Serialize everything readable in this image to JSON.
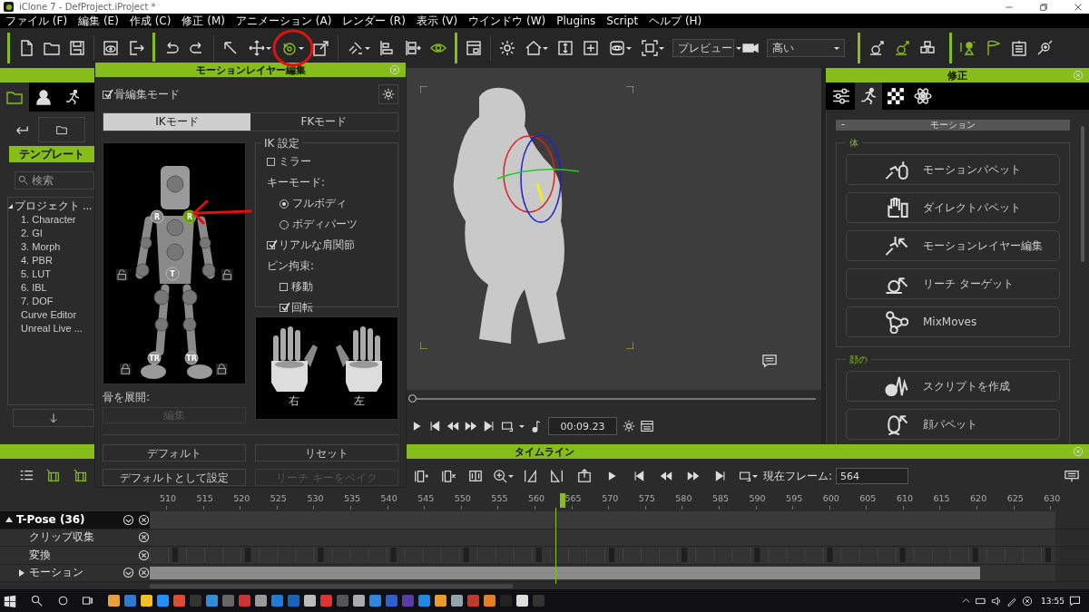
{
  "window": {
    "title": "iClone 7 - DefProject.iProject *"
  },
  "menu": [
    "ファイル (F)",
    "編集 (E)",
    "作成 (C)",
    "修正 (M)",
    "アニメーション (A)",
    "レンダー (R)",
    "表示 (V)",
    "ウインドウ (W)",
    "Plugins",
    "Script",
    "ヘルプ (H)"
  ],
  "toolbar": {
    "preview_dropdown": "プレビュー",
    "quality_dropdown": "高い"
  },
  "left_panel": {
    "tabs": [
      {
        "selected": true
      },
      {
        "selected": false
      },
      {
        "selected": false
      }
    ],
    "template_tab": "テンプレート",
    "search": {
      "placeholder": "検索"
    },
    "tree": [
      {
        "label": "プロジェクト ...",
        "expanded": true,
        "children": [
          {
            "label": "1. Character"
          },
          {
            "label": "2. GI"
          },
          {
            "label": "3. Morph"
          },
          {
            "label": "4. PBR"
          },
          {
            "label": "5. LUT"
          },
          {
            "label": "6. IBL"
          },
          {
            "label": "7. DOF"
          },
          {
            "label": "Curve Editor"
          },
          {
            "label": "Unreal Live ..."
          }
        ]
      }
    ]
  },
  "dialog": {
    "title": "モーションレイヤー編集",
    "bone_edit_mode": {
      "label": "骨編集モード",
      "checked": true
    },
    "tabs": [
      {
        "label": "IKモード",
        "selected": true
      },
      {
        "label": "FKモード",
        "selected": false
      }
    ],
    "body_markers": [
      {
        "label": "R",
        "selected": false
      },
      {
        "label": "R",
        "selected": true
      },
      {
        "label": "T",
        "selected": false
      },
      {
        "label": "TR",
        "selected": false
      },
      {
        "label": "TR",
        "selected": false
      }
    ],
    "ik_settings": {
      "title": "IK 設定",
      "mirror": {
        "label": "ミラー",
        "checked": false
      },
      "key_mode_label": "キーモード:",
      "key_modes": [
        {
          "label": "フルボディ",
          "selected": true
        },
        {
          "label": "ボディパーツ",
          "selected": false
        }
      ],
      "real_shoulder": {
        "label": "リアルな肩関節",
        "checked": true
      },
      "pin_label": "ピン拘束:",
      "pins": [
        {
          "label": "移動",
          "checked": false
        },
        {
          "label": "回転",
          "checked": true
        }
      ]
    },
    "hands": [
      {
        "label": "右"
      },
      {
        "label": "左"
      }
    ],
    "expand_bones_label": "骨を展開:",
    "edit_button": {
      "label": "編集",
      "disabled": true
    },
    "buttons": [
      {
        "label": "デフォルト",
        "disabled": false
      },
      {
        "label": "リセット",
        "disabled": false
      },
      {
        "label": "デフォルトとして設定",
        "disabled": false
      },
      {
        "label": "リーチ キーをベイク",
        "disabled": true
      }
    ]
  },
  "viewport": {
    "scrub": {
      "level": 0
    },
    "time": "00:09.23"
  },
  "right_panel": {
    "title": "修正",
    "tabs": [
      {
        "selected": false
      },
      {
        "selected": true
      },
      {
        "selected": false
      },
      {
        "selected": false
      }
    ],
    "section": "モーション",
    "groups": [
      {
        "title": "体",
        "items": [
          "モーションパペット",
          "ダイレクトパペット",
          "モーションレイヤー編集",
          "リーチ ターゲット",
          "MixMoves"
        ]
      },
      {
        "title": "顔の",
        "items": [
          "スクリプトを作成",
          "顔パペット"
        ]
      }
    ]
  },
  "timeline": {
    "title": "タイムライン",
    "current_frame_label": "現在フレーム:",
    "current_frame": "564",
    "playhead": {
      "level": 0.448
    },
    "ruler": [
      "510",
      "515",
      "520",
      "525",
      "530",
      "535",
      "540",
      "545",
      "550",
      "555",
      "560",
      "565",
      "570",
      "575",
      "580",
      "585",
      "590",
      "595",
      "600",
      "605",
      "610",
      "615",
      "620",
      "625",
      "630"
    ],
    "tracks": [
      {
        "label": "T-Pose (36)",
        "expanded": true,
        "children": [
          {
            "label": "クリップ収集"
          },
          {
            "label": "変換"
          },
          {
            "label": "モーション",
            "expanded": false
          }
        ]
      }
    ]
  },
  "taskbar": {
    "time": "13:55"
  }
}
